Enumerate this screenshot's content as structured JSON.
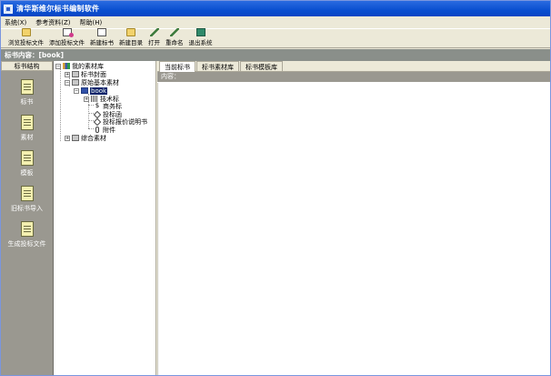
{
  "window": {
    "title": "清华斯维尔标书编制软件"
  },
  "menubar": {
    "items": [
      "系统(X)",
      "参考资料(Z)",
      "帮助(H)"
    ]
  },
  "toolbar": {
    "buttons": [
      {
        "label": "浏览投标文件",
        "icon": "folder-open-icon"
      },
      {
        "label": "添加投标文件",
        "icon": "add-document-icon"
      },
      {
        "label": "新建标书",
        "icon": "new-document-icon"
      },
      {
        "label": "新建目录",
        "icon": "new-folder-icon"
      },
      {
        "label": "打开",
        "icon": "open-pen-icon"
      },
      {
        "label": "重命名",
        "icon": "rename-pen-icon"
      },
      {
        "label": "退出系统",
        "icon": "exit-icon"
      }
    ]
  },
  "pathbar": {
    "text": "标书内容：[book]"
  },
  "left_panel": {
    "header": "标书结构",
    "items": [
      {
        "label": "标书",
        "icon": "document-icon"
      },
      {
        "label": "素材",
        "icon": "material-icon"
      },
      {
        "label": "模板",
        "icon": "template-icon"
      },
      {
        "label": "旧标书导入",
        "icon": "import-icon"
      },
      {
        "label": "生成投标文件",
        "icon": "generate-icon"
      }
    ]
  },
  "tree": {
    "root": "我的素材库",
    "cover": "标书封面",
    "basic": "原始基本素材",
    "selected": "book",
    "children": [
      "技术标",
      "商务标",
      "投标函",
      "投标报价说明书",
      "附件"
    ],
    "general": "综合素材"
  },
  "right_panel": {
    "tabs": [
      "当前标书",
      "标书素材库",
      "标书模板库"
    ],
    "active_tab": 0,
    "content_label": "内容："
  }
}
